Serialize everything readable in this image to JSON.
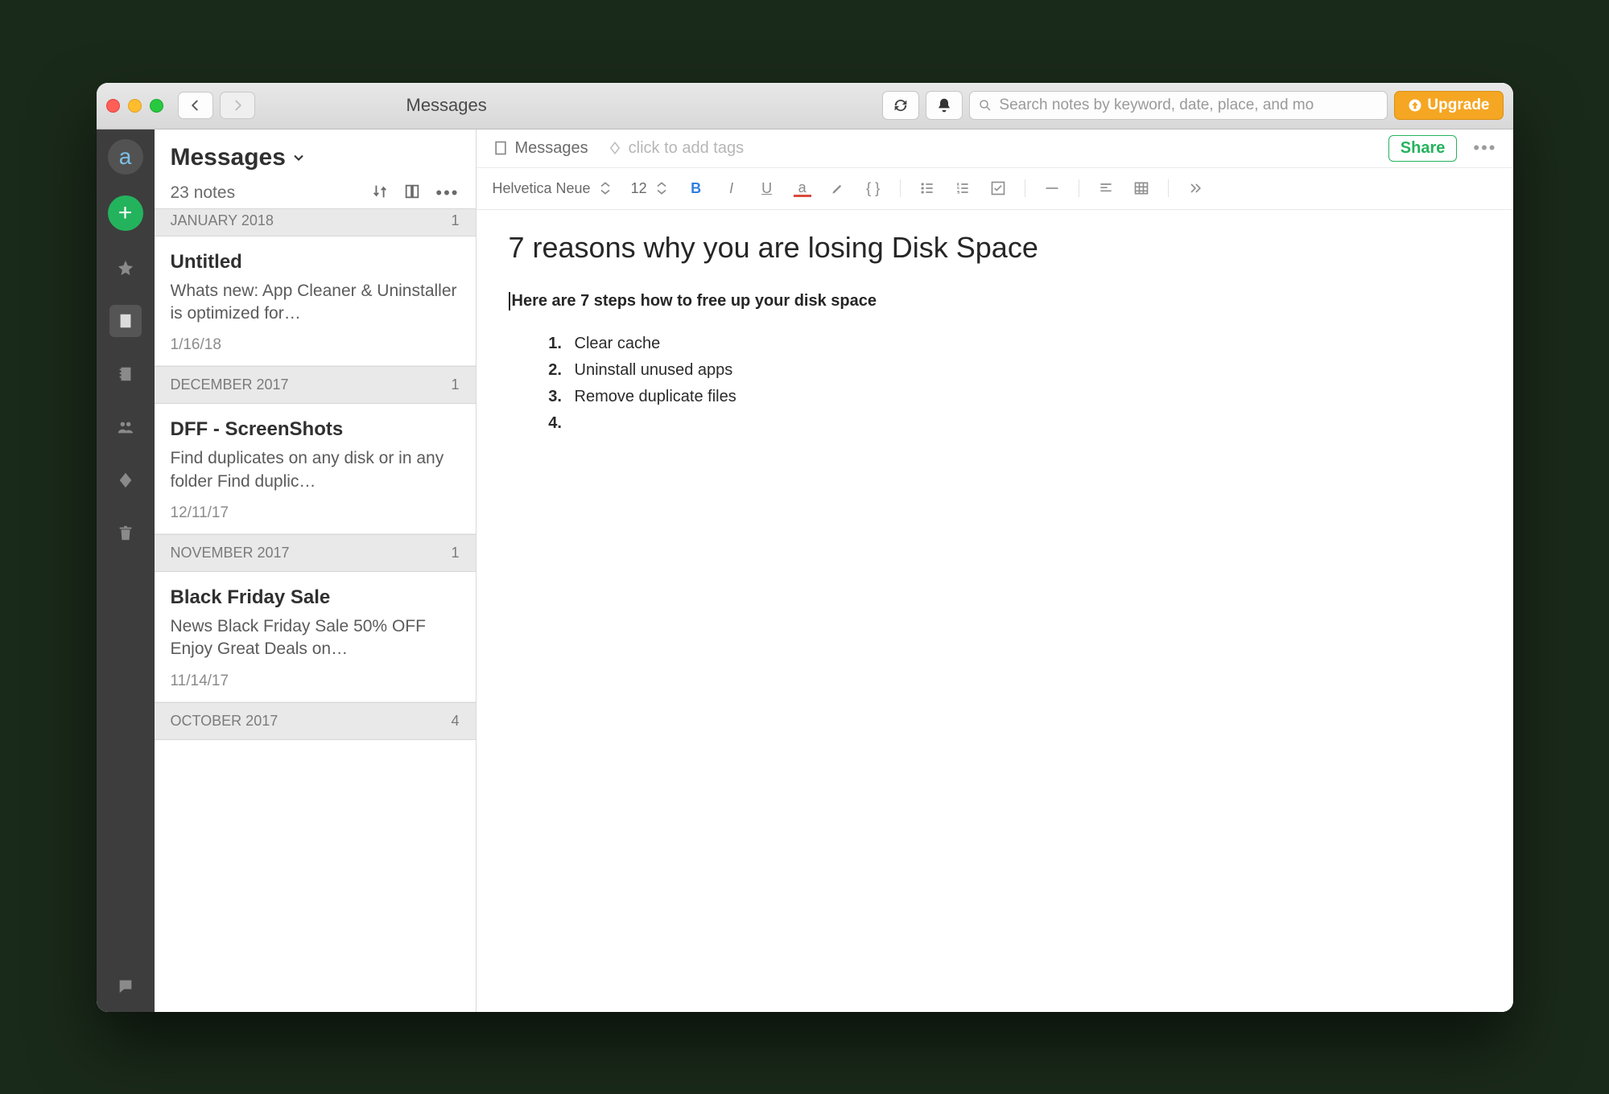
{
  "window": {
    "title": "Messages"
  },
  "toolbar": {
    "search_placeholder": "Search notes by keyword, date, place, and mo",
    "upgrade_label": "Upgrade"
  },
  "rail": {
    "items": [
      "logo",
      "new",
      "star",
      "notes",
      "notebooks",
      "shared",
      "tags",
      "trash"
    ],
    "footer": "work-chat"
  },
  "notelist": {
    "title": "Messages",
    "count_label": "23 notes",
    "sections": [
      {
        "label": "JANUARY 2018",
        "count": "1",
        "clipped": true,
        "notes": [
          {
            "title": "Untitled",
            "snippet": "Whats new: App Cleaner & Uninstaller is optimized for…",
            "date": "1/16/18"
          }
        ]
      },
      {
        "label": "DECEMBER 2017",
        "count": "1",
        "notes": [
          {
            "title": "DFF - ScreenShots",
            "snippet": "Find duplicates on any disk or in any folder Find duplic…",
            "date": "12/11/17"
          }
        ]
      },
      {
        "label": "NOVEMBER 2017",
        "count": "1",
        "notes": [
          {
            "title": "Black Friday Sale",
            "snippet": "News Black Friday Sale 50% OFF Enjoy Great Deals on…",
            "date": "11/14/17"
          }
        ]
      },
      {
        "label": "OCTOBER 2017",
        "count": "4",
        "notes": []
      }
    ]
  },
  "editor": {
    "notebook": "Messages",
    "tags_placeholder": "click to add tags",
    "share_label": "Share",
    "font_family": "Helvetica Neue",
    "font_size": "12",
    "title": "7 reasons why you are losing Disk Space",
    "lead": "Here are 7 steps how to free up your disk space",
    "list": [
      "Clear cache",
      "Uninstall unused apps",
      "Remove duplicate files",
      ""
    ]
  },
  "colors": {
    "accent_green": "#24b35d",
    "upgrade_orange": "#f5a623",
    "bold_blue": "#2f7de1",
    "underline_red": "#d84a3c"
  }
}
